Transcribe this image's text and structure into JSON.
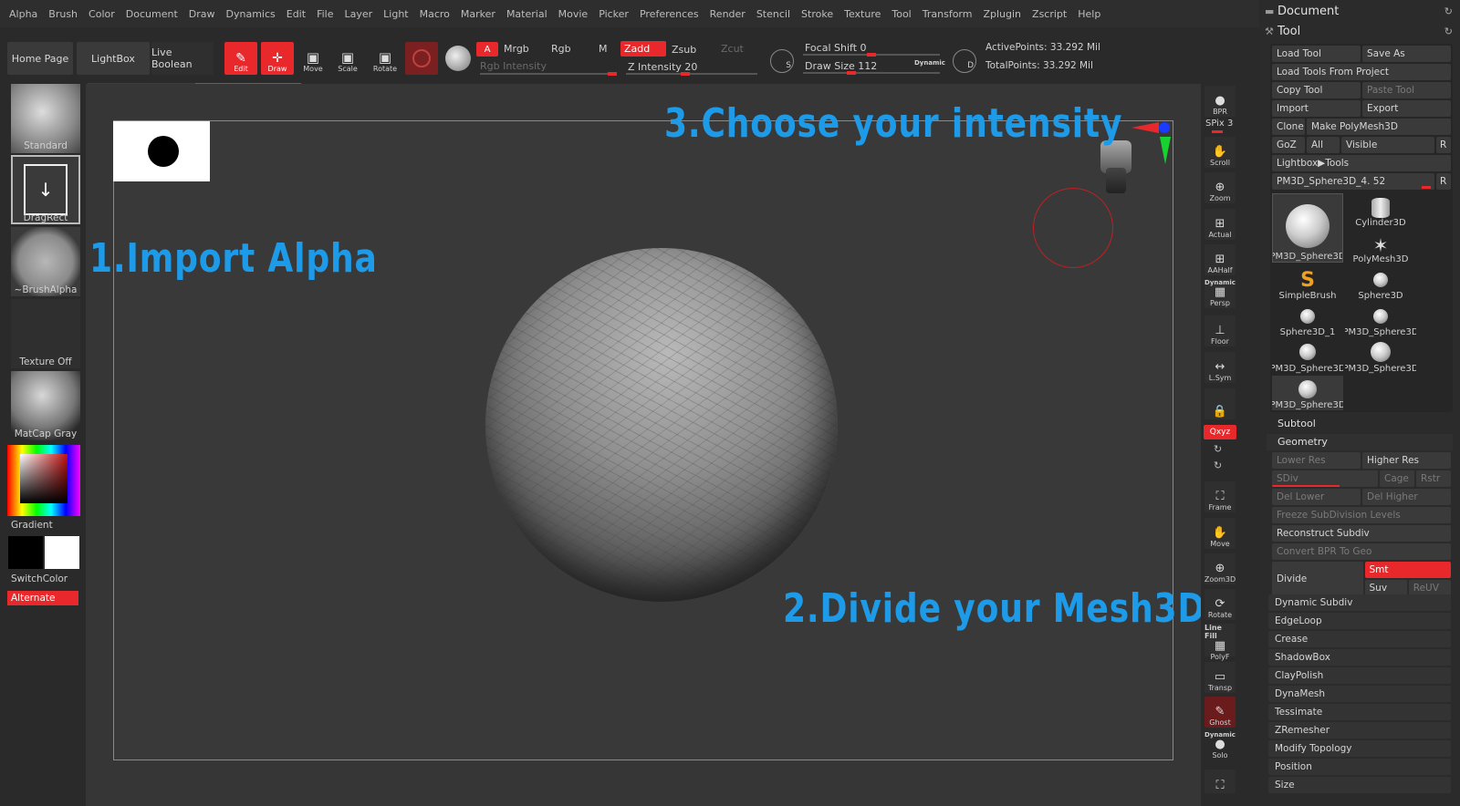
{
  "menu": [
    "Alpha",
    "Brush",
    "Color",
    "Document",
    "Draw",
    "Dynamics",
    "Edit",
    "File",
    "Layer",
    "Light",
    "Macro",
    "Marker",
    "Material",
    "Movie",
    "Picker",
    "Preferences",
    "Render",
    "Stencil",
    "Stroke",
    "Texture",
    "Tool",
    "Transform",
    "Zplugin",
    "Zscript",
    "Help"
  ],
  "toolbar": {
    "home": "Home Page",
    "lightbox": "LightBox",
    "liveboolean": "Live Boolean",
    "edit": "Edit",
    "draw": "Draw",
    "move": "Move",
    "scale": "Scale",
    "rotate": "Rotate",
    "a": "A",
    "mrgb": "Mrgb",
    "rgb": "Rgb",
    "m": "M",
    "zadd": "Zadd",
    "zsub": "Zsub",
    "zcut": "Zcut",
    "rgb_intensity": "Rgb Intensity",
    "z_intensity": "Z Intensity 20",
    "focal_shift": "Focal Shift 0",
    "draw_size": "Draw Size 112",
    "dynamic": "Dynamic",
    "active_points": "ActivePoints: 33.292 Mil",
    "total_points": "TotalPoints: 33.292 Mil",
    "s_label": "S",
    "d_label": "D"
  },
  "left": {
    "brush": "Standard",
    "stroke": "DragRect",
    "alpha": "~BrushAlpha",
    "texture": "Texture Off",
    "material": "MatCap Gray",
    "gradient": "Gradient",
    "switchcolor": "SwitchColor",
    "alternate": "Alternate"
  },
  "canvas": {
    "step1": "1.Import Alpha",
    "step2": "2.Divide your Mesh3D",
    "step3": "3.Choose your intensity"
  },
  "shelf": {
    "bpr": "BPR",
    "spix": "SPix 3",
    "scroll": "Scroll",
    "zoom": "Zoom",
    "actual": "Actual",
    "aahalf": "AAHalf",
    "dynamic": "Dynamic",
    "persp": "Persp",
    "floor": "Floor",
    "lsym": "L.Sym",
    "xyz": "Qxyz",
    "frame": "Frame",
    "move": "Move",
    "zoom3d": "Zoom3D",
    "rotate": "Rotate",
    "linefill": "Line Fill",
    "polyf": "PolyF",
    "transp": "Transp",
    "ghost": "Ghost",
    "dynamic2": "Dynamic",
    "solo": "Solo"
  },
  "rpanel": {
    "document": "Document",
    "tool": "Tool",
    "load_tool": "Load Tool",
    "save_as": "Save As",
    "load_from_project": "Load Tools From Project",
    "copy_tool": "Copy Tool",
    "paste_tool": "Paste Tool",
    "import": "Import",
    "export": "Export",
    "clone": "Clone",
    "make_polymesh": "Make PolyMesh3D",
    "goz": "GoZ",
    "all": "All",
    "visible": "Visible",
    "r": "R",
    "lightbox_tools": "Lightbox▶Tools",
    "current_tool": "PM3D_Sphere3D_4. 52",
    "tools": [
      "PM3D_Sphere3D",
      "Cylinder3D",
      "PolyMesh3D",
      "SimpleBrush",
      "Sphere3D",
      "Sphere3D_1",
      "PM3D_Sphere3D",
      "PM3D_Sphere3D",
      "PM3D_Sphere3D",
      "PM3D_Sphere3D"
    ],
    "subtool": "Subtool",
    "geometry": "Geometry",
    "lower_res": "Lower Res",
    "higher_res": "Higher Res",
    "sdiv": "SDiv",
    "cage": "Cage",
    "rstr": "Rstr",
    "del_lower": "Del Lower",
    "del_higher": "Del Higher",
    "freeze": "Freeze SubDivision Levels",
    "reconstruct": "Reconstruct Subdiv",
    "convert_bpr": "Convert BPR To Geo",
    "divide": "Divide",
    "smt": "Smt",
    "suv": "Suv",
    "reuv": "ReUV",
    "items": [
      "Dynamic Subdiv",
      "EdgeLoop",
      "Crease",
      "ShadowBox",
      "ClayPolish",
      "DynaMesh",
      "Tessimate",
      "ZRemesher",
      "Modify Topology",
      "Position",
      "Size"
    ]
  }
}
